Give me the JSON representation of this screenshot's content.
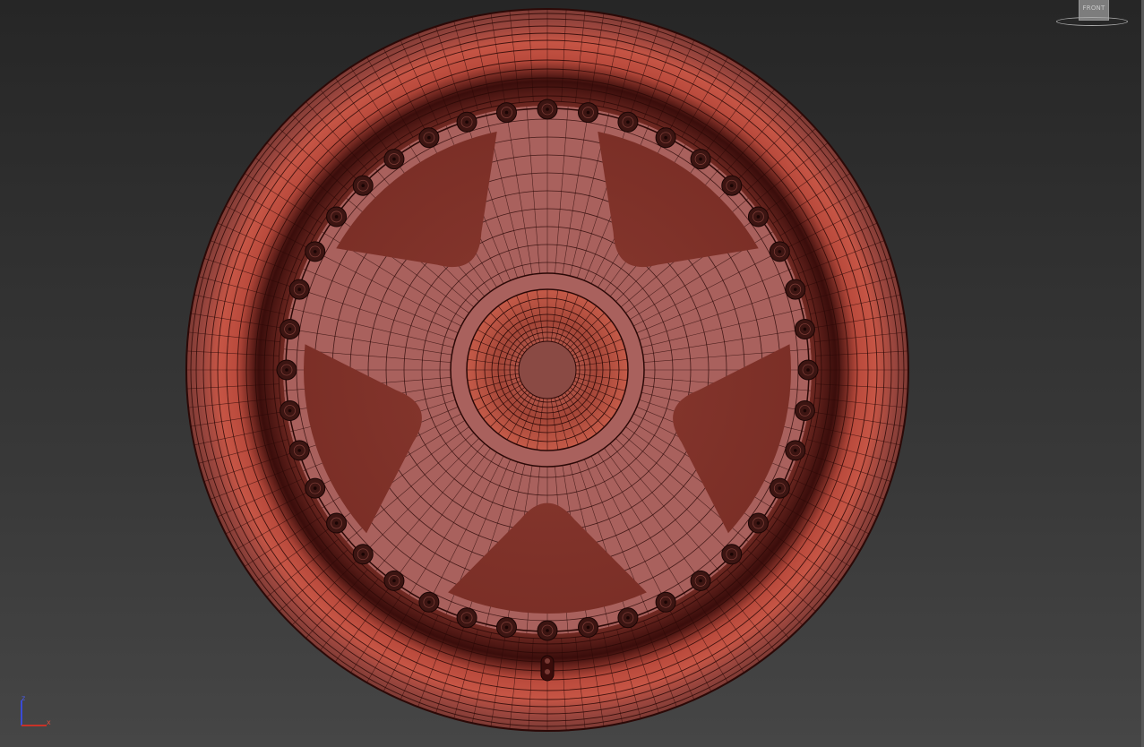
{
  "viewport": {
    "viewcube_label": "FRONT",
    "axis_labels": {
      "x": "x",
      "z": "z"
    }
  },
  "wheel": {
    "spoke_count": 5,
    "rim_bolt_count": 40,
    "colors": {
      "rim_dark": "#3a0d0b",
      "rim_mid": "#8a3a30",
      "rim_bright": "#c65545",
      "face": "#a9615d",
      "wire": "#2b0907",
      "bolt": "#3c1512"
    }
  }
}
